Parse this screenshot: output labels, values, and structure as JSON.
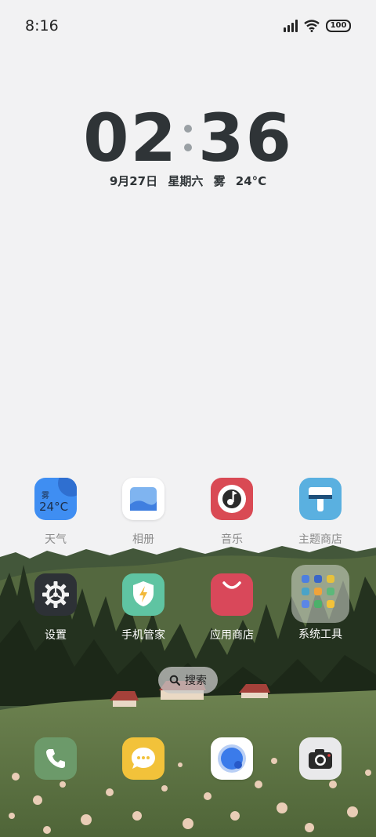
{
  "status_bar": {
    "time": "8:16",
    "battery": "100"
  },
  "clock": {
    "hours": "02",
    "minutes": "36"
  },
  "date_line": "9月27日 星期六 雾 24°C",
  "weather_widget": {
    "condition": "雾",
    "temperature": "24°C"
  },
  "apps_row1": [
    {
      "label": "天气",
      "icon": "weather-icon"
    },
    {
      "label": "相册",
      "icon": "gallery-icon"
    },
    {
      "label": "音乐",
      "icon": "music-icon"
    },
    {
      "label": "主题商店",
      "icon": "theme-store-icon"
    }
  ],
  "apps_row2": [
    {
      "label": "设置",
      "icon": "settings-icon"
    },
    {
      "label": "手机管家",
      "icon": "phone-manager-icon"
    },
    {
      "label": "应用商店",
      "icon": "app-store-icon"
    },
    {
      "label": "系统工具",
      "icon": "system-tools-folder-icon"
    }
  ],
  "search": {
    "label": "搜索"
  },
  "dock": [
    {
      "icon": "phone-icon"
    },
    {
      "icon": "messages-icon"
    },
    {
      "icon": "browser-icon"
    },
    {
      "icon": "camera-icon"
    }
  ],
  "colors": {
    "background": "#f2f2f3",
    "weather": "#3f8ef2",
    "music": "#d94a54",
    "theme_store": "#5ab0e0",
    "settings": "#2d3136",
    "phone_manager": "#5fc4a2",
    "app_store": "#d9485a",
    "phone": "#6c9a6a",
    "messages": "#f2c23a"
  }
}
